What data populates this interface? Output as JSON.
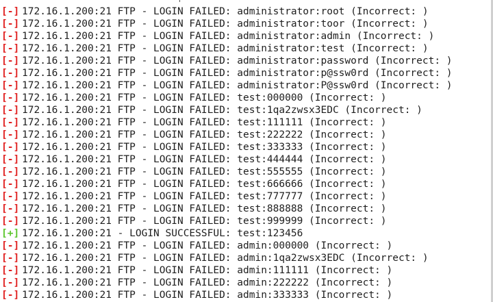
{
  "colors": {
    "fail_marker": "#e02020",
    "success_marker": "#5cc62c",
    "text": "#1e1e1e",
    "background": "#ffffff"
  },
  "lines": [
    {
      "status": "fail",
      "marker": "[-]",
      "text": "172.16.1.200:21 FTP - LOGIN FAILED: administrator:root (Incorrect: )"
    },
    {
      "status": "fail",
      "marker": "[-]",
      "text": "172.16.1.200:21 FTP - LOGIN FAILED: administrator:toor (Incorrect: )"
    },
    {
      "status": "fail",
      "marker": "[-]",
      "text": "172.16.1.200:21 FTP - LOGIN FAILED: administrator:admin (Incorrect: )"
    },
    {
      "status": "fail",
      "marker": "[-]",
      "text": "172.16.1.200:21 FTP - LOGIN FAILED: administrator:test (Incorrect: )"
    },
    {
      "status": "fail",
      "marker": "[-]",
      "text": "172.16.1.200:21 FTP - LOGIN FAILED: administrator:password (Incorrect: )"
    },
    {
      "status": "fail",
      "marker": "[-]",
      "text": "172.16.1.200:21 FTP - LOGIN FAILED: administrator:p@ssw0rd (Incorrect: )"
    },
    {
      "status": "fail",
      "marker": "[-]",
      "text": "172.16.1.200:21 FTP - LOGIN FAILED: administrator:P@ssw0rd (Incorrect: )"
    },
    {
      "status": "fail",
      "marker": "[-]",
      "text": "172.16.1.200:21 FTP - LOGIN FAILED: test:000000 (Incorrect: )"
    },
    {
      "status": "fail",
      "marker": "[-]",
      "text": "172.16.1.200:21 FTP - LOGIN FAILED: test:1qa2zwsx3EDC (Incorrect: )"
    },
    {
      "status": "fail",
      "marker": "[-]",
      "text": "172.16.1.200:21 FTP - LOGIN FAILED: test:111111 (Incorrect: )"
    },
    {
      "status": "fail",
      "marker": "[-]",
      "text": "172.16.1.200:21 FTP - LOGIN FAILED: test:222222 (Incorrect: )"
    },
    {
      "status": "fail",
      "marker": "[-]",
      "text": "172.16.1.200:21 FTP - LOGIN FAILED: test:333333 (Incorrect: )"
    },
    {
      "status": "fail",
      "marker": "[-]",
      "text": "172.16.1.200:21 FTP - LOGIN FAILED: test:444444 (Incorrect: )"
    },
    {
      "status": "fail",
      "marker": "[-]",
      "text": "172.16.1.200:21 FTP - LOGIN FAILED: test:555555 (Incorrect: )"
    },
    {
      "status": "fail",
      "marker": "[-]",
      "text": "172.16.1.200:21 FTP - LOGIN FAILED: test:666666 (Incorrect: )"
    },
    {
      "status": "fail",
      "marker": "[-]",
      "text": "172.16.1.200:21 FTP - LOGIN FAILED: test:777777 (Incorrect: )"
    },
    {
      "status": "fail",
      "marker": "[-]",
      "text": "172.16.1.200:21 FTP - LOGIN FAILED: test:888888 (Incorrect: )"
    },
    {
      "status": "fail",
      "marker": "[-]",
      "text": "172.16.1.200:21 FTP - LOGIN FAILED: test:999999 (Incorrect: )"
    },
    {
      "status": "ok",
      "marker": "[+]",
      "text": "172.16.1.200:21 - LOGIN SUCCESSFUL: test:123456"
    },
    {
      "status": "fail",
      "marker": "[-]",
      "text": "172.16.1.200:21 FTP - LOGIN FAILED: admin:000000 (Incorrect: )"
    },
    {
      "status": "fail",
      "marker": "[-]",
      "text": "172.16.1.200:21 FTP - LOGIN FAILED: admin:1qa2zwsx3EDC (Incorrect: )"
    },
    {
      "status": "fail",
      "marker": "[-]",
      "text": "172.16.1.200:21 FTP - LOGIN FAILED: admin:111111 (Incorrect: )"
    },
    {
      "status": "fail",
      "marker": "[-]",
      "text": "172.16.1.200:21 FTP - LOGIN FAILED: admin:222222 (Incorrect: )"
    },
    {
      "status": "fail",
      "marker": "[-]",
      "text": "172.16.1.200:21 FTP - LOGIN FAILED: admin:333333 (Incorrect: )"
    }
  ]
}
